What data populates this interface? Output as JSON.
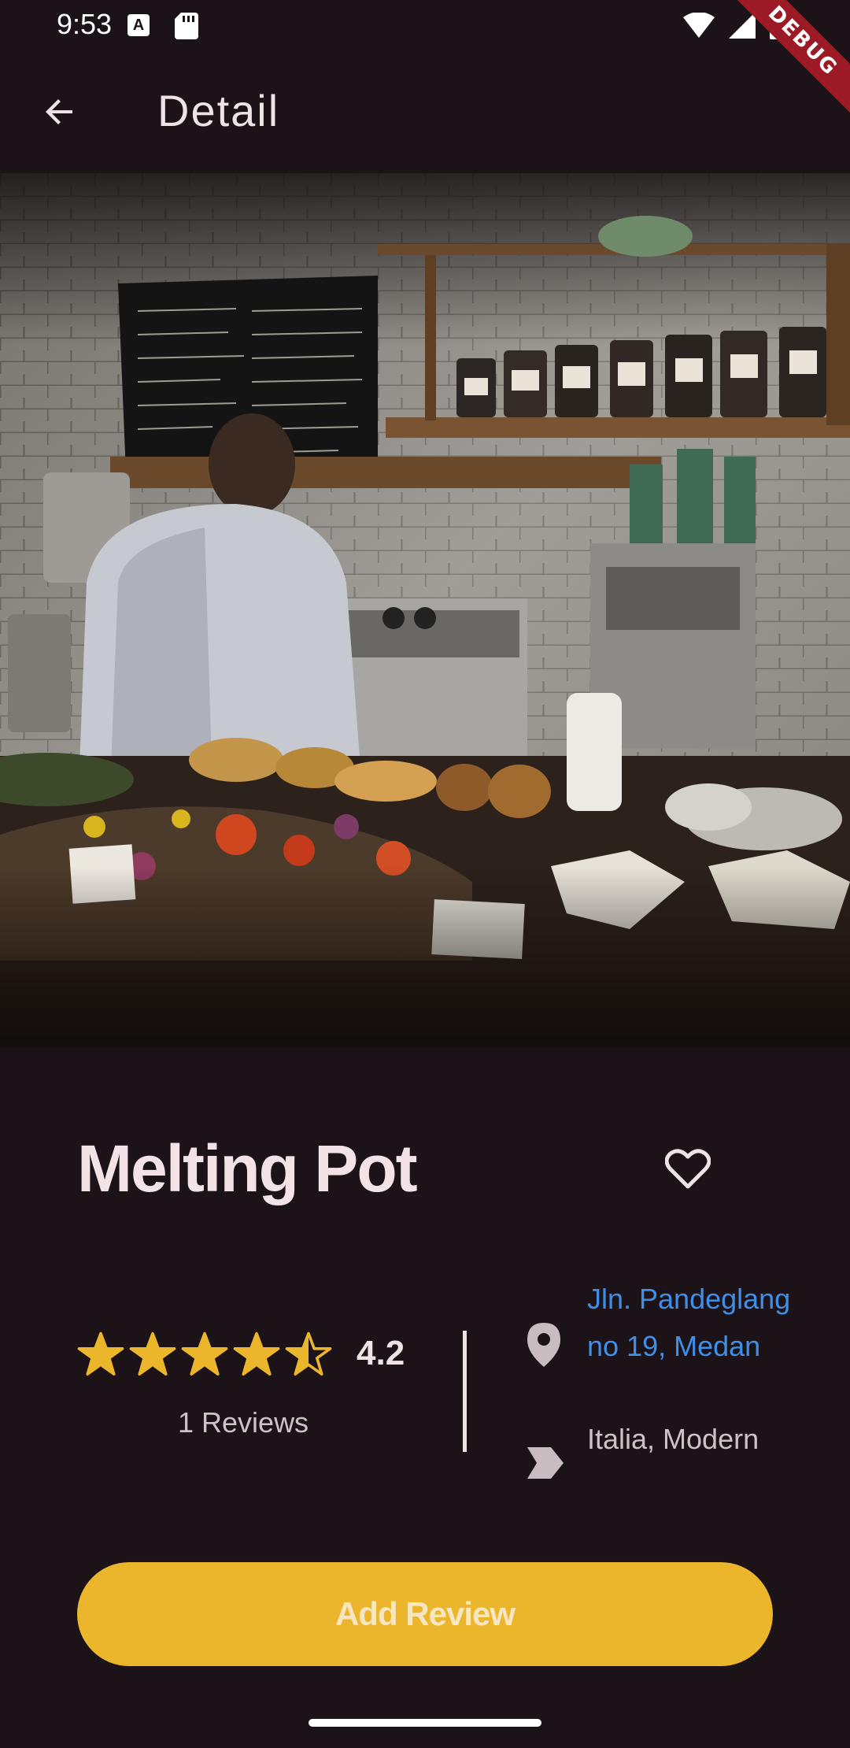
{
  "status_bar": {
    "time": "9:53",
    "notification_icons": [
      "a-icon",
      "sd-card-icon"
    ],
    "system_icons": [
      "wifi-icon",
      "signal-icon",
      "battery-icon"
    ]
  },
  "debug_banner": "DEBUG",
  "app_bar": {
    "back_icon": "arrow-back-icon",
    "title": "Detail"
  },
  "hero": {
    "image": "photo-cafe-counter"
  },
  "restaurant": {
    "name": "Melting Pot",
    "favorite_icon": "heart-outline-icon",
    "rating_value": "4.2",
    "rating": 4.2,
    "rating_max": 5,
    "reviews_label": "1 Reviews",
    "address": "Jln. Pandeglang no 19, Medan",
    "categories": "Italia, Modern"
  },
  "actions": {
    "add_review_label": "Add Review"
  },
  "colors": {
    "background": "#1b1317",
    "accent": "#ecb62c",
    "star": "#ecb62c",
    "link": "#3f8fe8",
    "text_primary": "#efe3e6",
    "text_secondary": "#cfc2c6",
    "debug": "#9b1a25"
  }
}
